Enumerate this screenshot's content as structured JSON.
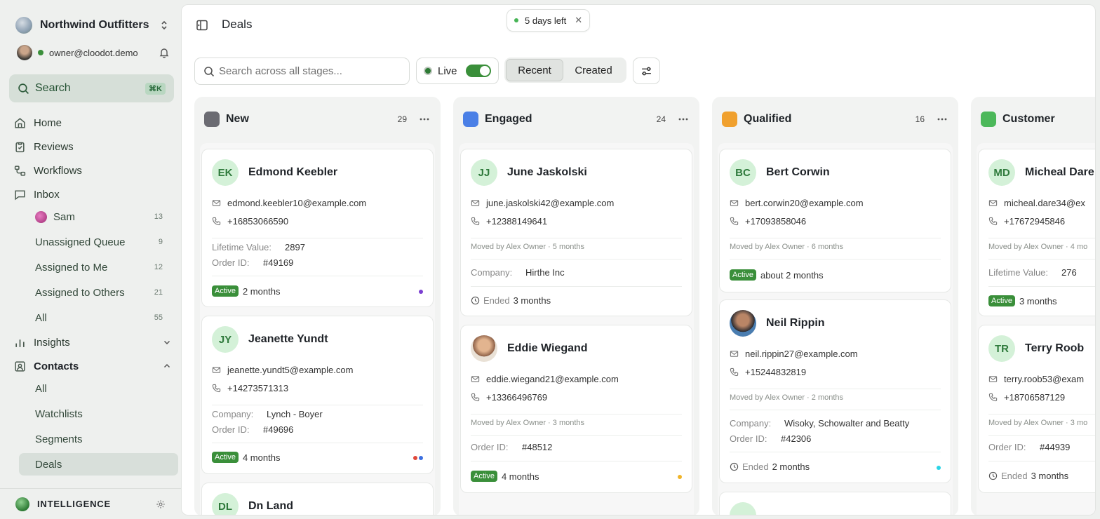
{
  "workspace": {
    "name": "Northwind Outfitters"
  },
  "user": {
    "email": "owner@cloodot.demo"
  },
  "sidebar": {
    "search_label": "Search",
    "search_shortcut": "⌘K",
    "nav": {
      "home": "Home",
      "reviews": "Reviews",
      "workflows": "Workflows",
      "inbox": "Inbox",
      "insights": "Insights",
      "contacts": "Contacts"
    },
    "inbox_items": [
      {
        "label": "Sam",
        "count": "13"
      },
      {
        "label": "Unassigned Queue",
        "count": "9"
      },
      {
        "label": "Assigned to Me",
        "count": "12"
      },
      {
        "label": "Assigned to Others",
        "count": "21"
      },
      {
        "label": "All",
        "count": "55"
      }
    ],
    "contacts_items": [
      "All",
      "Watchlists",
      "Segments",
      "Deals"
    ],
    "footer_label": "INTELLIGENCE"
  },
  "header": {
    "title": "Deals",
    "trial": "5 days left",
    "trial_close": "✕"
  },
  "toolbar": {
    "search_placeholder": "Search across all stages...",
    "live_label": "Live",
    "sort_recent": "Recent",
    "sort_created": "Created"
  },
  "columns": [
    {
      "name": "New",
      "count": "29",
      "color": "#6b6b72",
      "cards": [
        {
          "initials": "EK",
          "name": "Edmond Keebler",
          "email": "edmond.keebler10@example.com",
          "phone": "+16853066590",
          "fields": [
            {
              "k": "Lifetime Value:",
              "v": "2897"
            },
            {
              "k": "Order ID:",
              "v": "#49169"
            }
          ],
          "badge": "Active",
          "duration": "2 months",
          "dots": [
            "#7b3fd1"
          ]
        },
        {
          "initials": "JY",
          "name": "Jeanette Yundt",
          "email": "jeanette.yundt5@example.com",
          "phone": "+14273571313",
          "fields": [
            {
              "k": "Company:",
              "v": "Lynch - Boyer"
            },
            {
              "k": "Order ID:",
              "v": "#49696"
            }
          ],
          "badge": "Active",
          "duration": "4 months",
          "dots": [
            "#e0483b",
            "#3b6fe0"
          ]
        }
      ]
    },
    {
      "name": "Engaged",
      "count": "24",
      "color": "#4a7fe6",
      "cards": [
        {
          "initials": "JJ",
          "name": "June Jaskolski",
          "email": "june.jaskolski42@example.com",
          "phone": "+12388149641",
          "moved": "Moved by Alex Owner · 5 months",
          "fields": [
            {
              "k": "Company:",
              "v": "Hirthe Inc"
            }
          ],
          "ended_label": "Ended",
          "duration": "3 months"
        },
        {
          "name": "Eddie Wiegand",
          "email": "eddie.wiegand21@example.com",
          "phone": "+13366496769",
          "moved": "Moved by Alex Owner · 3 months",
          "fields": [
            {
              "k": "Order ID:",
              "v": "#48512"
            }
          ],
          "badge": "Active",
          "duration": "4 months",
          "dots": [
            "#f0b429"
          ]
        }
      ]
    },
    {
      "name": "Qualified",
      "count": "16",
      "color": "#f0a02e",
      "cards": [
        {
          "initials": "BC",
          "name": "Bert Corwin",
          "email": "bert.corwin20@example.com",
          "phone": "+17093858046",
          "moved": "Moved by Alex Owner · 6 months",
          "badge": "Active",
          "duration": "about 2 months"
        },
        {
          "name": "Neil Rippin",
          "email": "neil.rippin27@example.com",
          "phone": "+15244832819",
          "moved": "Moved by Alex Owner · 2 months",
          "fields": [
            {
              "k": "Company:",
              "v": "Wisoky, Schowalter and Beatty"
            },
            {
              "k": "Order ID:",
              "v": "#42306"
            }
          ],
          "ended_label": "Ended",
          "duration": "2 months",
          "dots": [
            "#2ad4e6"
          ]
        }
      ]
    },
    {
      "name": "Customer",
      "color": "#4cb85a",
      "cards": [
        {
          "initials": "MD",
          "name": "Micheal Dare",
          "email": "micheal.dare34@ex",
          "phone": "+17672945846",
          "moved": "Moved by Alex Owner · 4 mo",
          "fields": [
            {
              "k": "Lifetime Value:",
              "v": "276"
            }
          ],
          "badge": "Active",
          "duration": "3 months"
        },
        {
          "initials": "TR",
          "name": "Terry Roob",
          "email": "terry.roob53@exam",
          "phone": "+18706587129",
          "moved": "Moved by Alex Owner · 3 mo",
          "fields": [
            {
              "k": "Order ID:",
              "v": "#44939"
            }
          ],
          "ended_label": "Ended",
          "duration": "3 months"
        }
      ]
    }
  ],
  "peek": {
    "initials": "DL",
    "name": "Dn Land"
  }
}
